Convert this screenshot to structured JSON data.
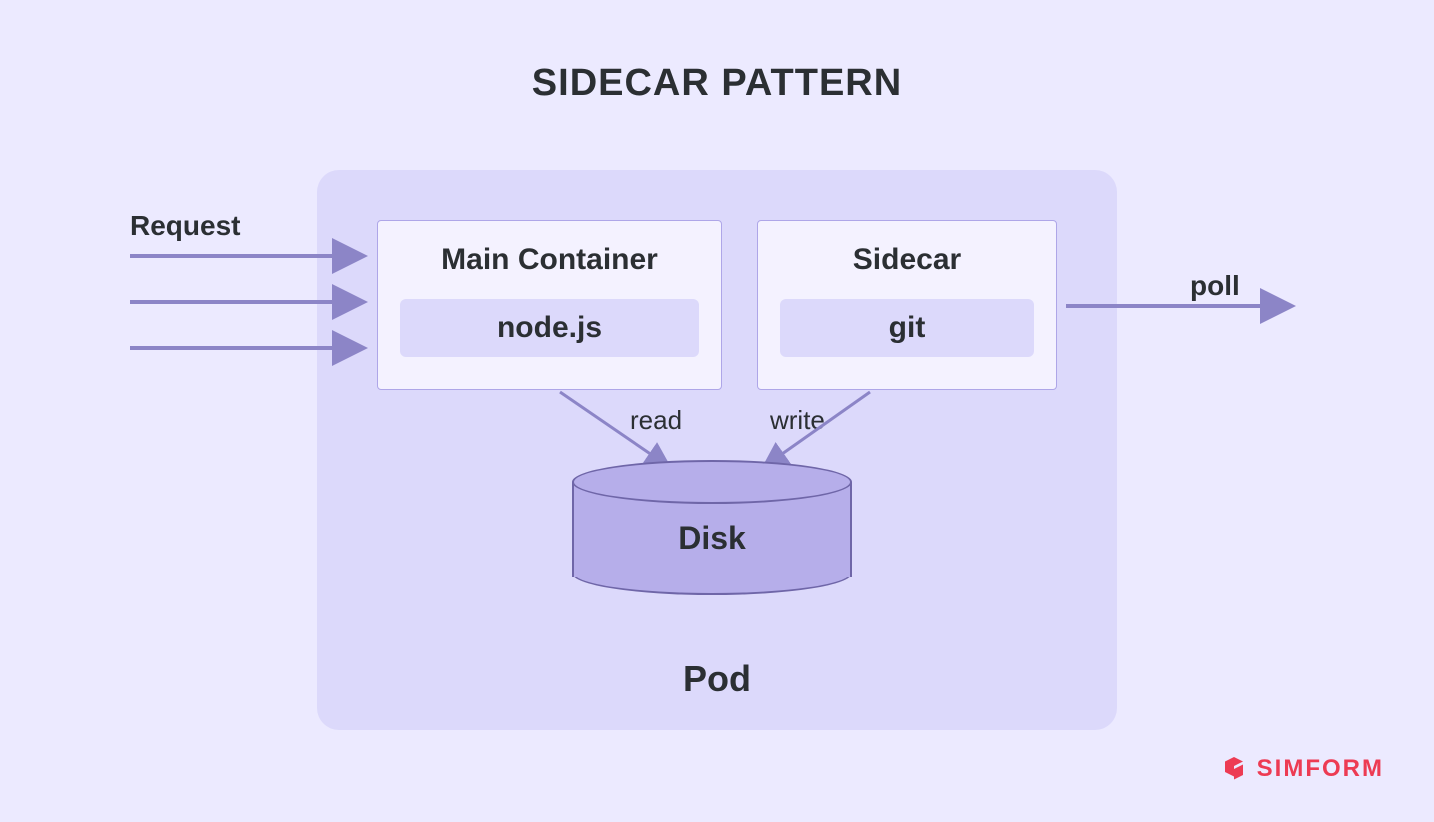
{
  "title": "SIDECAR PATTERN",
  "labels": {
    "request": "Request",
    "poll": "poll",
    "read": "read",
    "write": "write"
  },
  "pod": {
    "label": "Pod",
    "mainContainer": {
      "title": "Main Container",
      "runtime": "node.js"
    },
    "sidecar": {
      "title": "Sidecar",
      "runtime": "git"
    },
    "disk": {
      "label": "Disk"
    }
  },
  "brand": {
    "name": "SIMFORM"
  },
  "colors": {
    "background": "#eceaff",
    "podBackground": "#dcd9fb",
    "containerBackground": "#f4f2ff",
    "containerBorder": "#aea6e8",
    "diskFill": "#b6aeea",
    "diskStroke": "#6f66a8",
    "arrow": "#8c85c7",
    "brand": "#ed3b53",
    "text": "#2b2f33"
  }
}
